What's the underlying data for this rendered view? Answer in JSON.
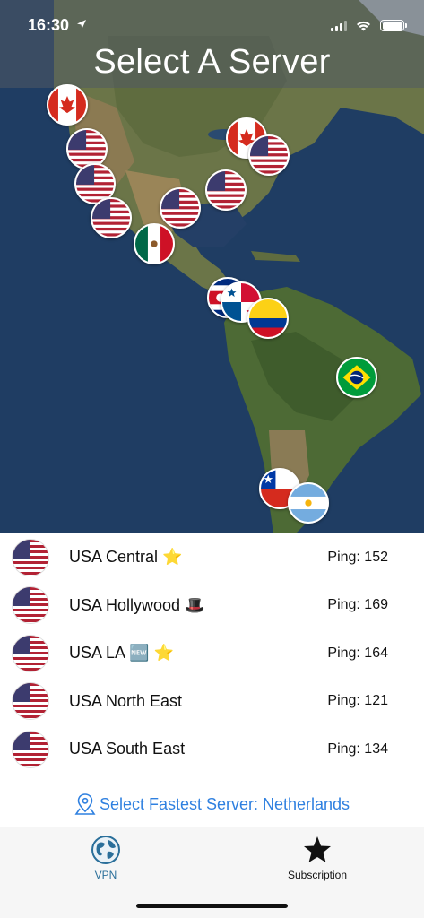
{
  "status_bar": {
    "time": "16:30"
  },
  "header": {
    "title": "Select A Server"
  },
  "servers": [
    {
      "name": "USA Central",
      "emoji": "⭐",
      "ping": "Ping: 152"
    },
    {
      "name": "USA Hollywood",
      "emoji": "🎩",
      "ping": "Ping: 169"
    },
    {
      "name": "USA LA",
      "emoji": "🆕 ⭐",
      "ping": "Ping: 164"
    },
    {
      "name": "USA North East",
      "emoji": "",
      "ping": "Ping: 121"
    },
    {
      "name": "USA South East",
      "emoji": "",
      "ping": "Ping: 134"
    }
  ],
  "fastest": {
    "label": "Select Fastest Server: Netherlands",
    "icon": "location-pin-icon"
  },
  "tabs": [
    {
      "label": "VPN",
      "icon": "globe-icon",
      "active": true
    },
    {
      "label": "Subscription",
      "icon": "star-icon",
      "active": false
    }
  ],
  "colors": {
    "accent": "#2f80e0",
    "tab_active": "#2a6f9a"
  }
}
